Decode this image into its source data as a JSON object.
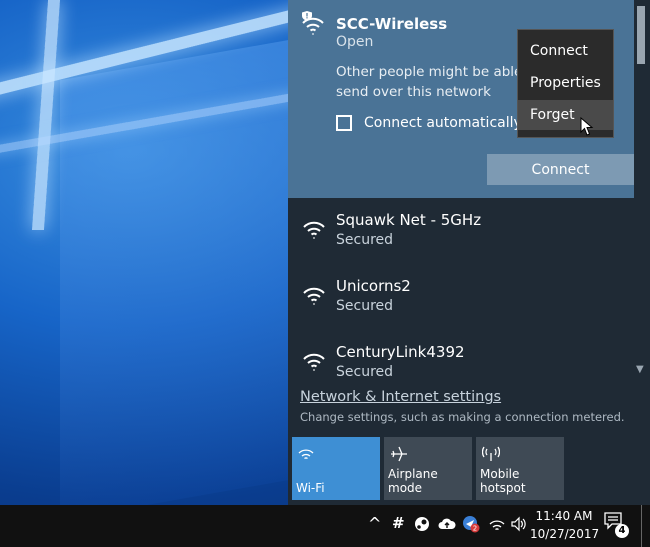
{
  "selected_network": {
    "name": "SCC-Wireless",
    "status": "Open",
    "description": "Other people might be able t\nsend over this network",
    "connect_automatically_label": "Connect automatically",
    "connect_button_label": "Connect"
  },
  "context_menu": {
    "items": [
      "Connect",
      "Properties",
      "Forget"
    ],
    "hovered": "Forget"
  },
  "networks": [
    {
      "name": "Squawk Net - 5GHz",
      "status": "Secured"
    },
    {
      "name": "Unicorns2",
      "status": "Secured"
    },
    {
      "name": "CenturyLink4392",
      "status": "Secured"
    }
  ],
  "settings": {
    "link": "Network & Internet settings",
    "subtitle": "Change settings, such as making a connection metered."
  },
  "quick_actions": {
    "wifi": "Wi-Fi",
    "airplane": "Airplane mode",
    "hotspot": "Mobile hotspot"
  },
  "taskbar": {
    "time": "11:40 AM",
    "date": "10/27/2017",
    "notification_count": "4",
    "chevron": "^"
  },
  "colors": {
    "flyout_bg": "#1f2a35",
    "selected_bg": "#4a7396",
    "accent": "#3e8fd4"
  }
}
